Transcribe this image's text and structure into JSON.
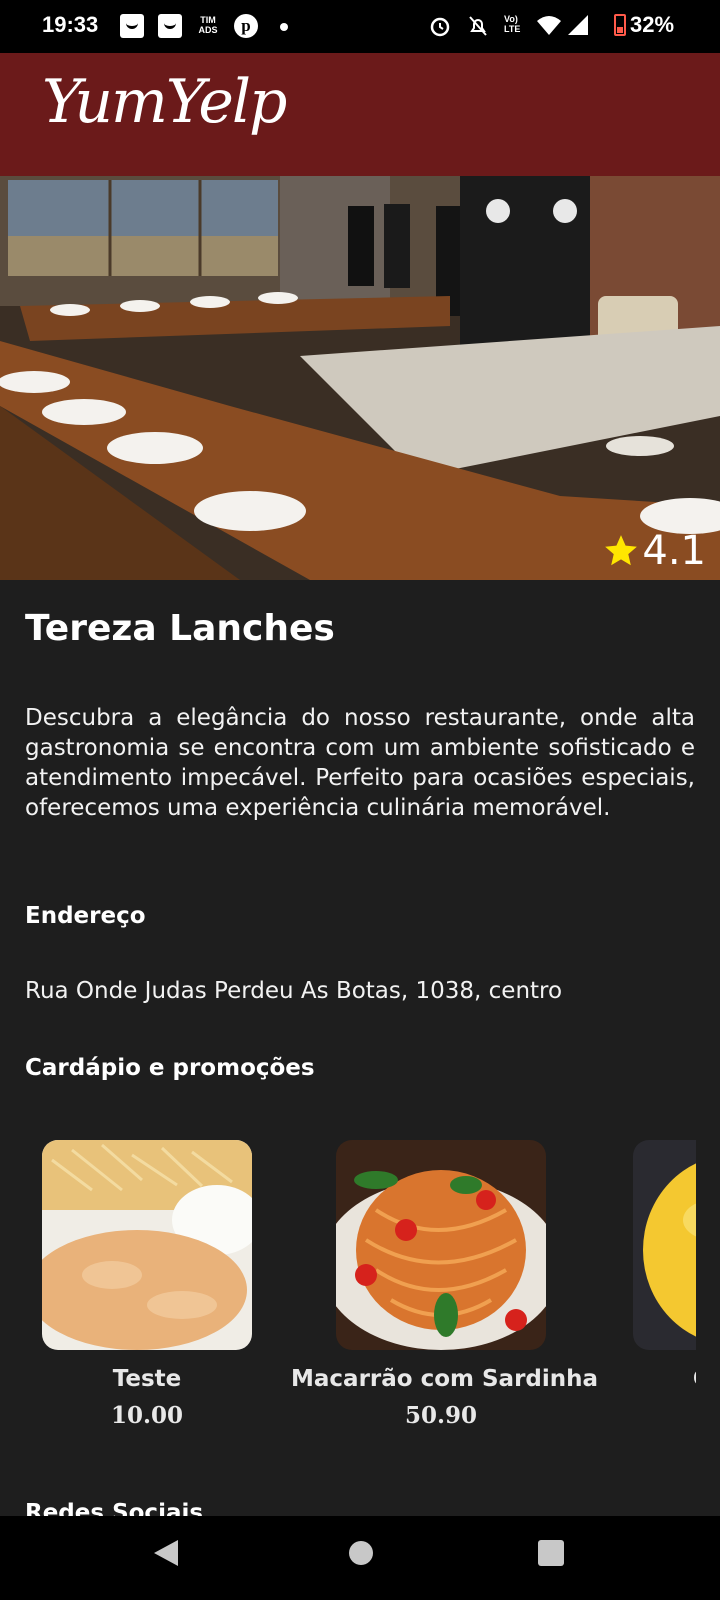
{
  "status_bar": {
    "time": "19:33",
    "carrier": "TIM ADS",
    "battery": "32%"
  },
  "app": {
    "logo": "YumYelp"
  },
  "restaurant": {
    "rating": "4.1",
    "name": "Tereza Lanches",
    "description": "Descubra a elegância do nosso restaurante, onde alta gastronomia se encontra com um ambiente sofisticado e atendimento impecável. Perfeito para ocasiões especiais, oferecemos uma experiência culinária memorável.",
    "address_heading": "Endereço",
    "address": "Rua Onde Judas Perdeu As Botas, 1038, centro",
    "menu_heading": "Cardápio e promoções",
    "menu_items": [
      {
        "name": "Teste",
        "price": "10.00"
      },
      {
        "name": "Macarrão com Sardinha",
        "price": "50.90"
      },
      {
        "name": "Cuscuz",
        "price": ""
      }
    ],
    "social_heading": "Redes Sociais"
  },
  "colors": {
    "appbar": "#6b1a1a",
    "background": "#1e1e1e",
    "star": "#ffe600"
  }
}
